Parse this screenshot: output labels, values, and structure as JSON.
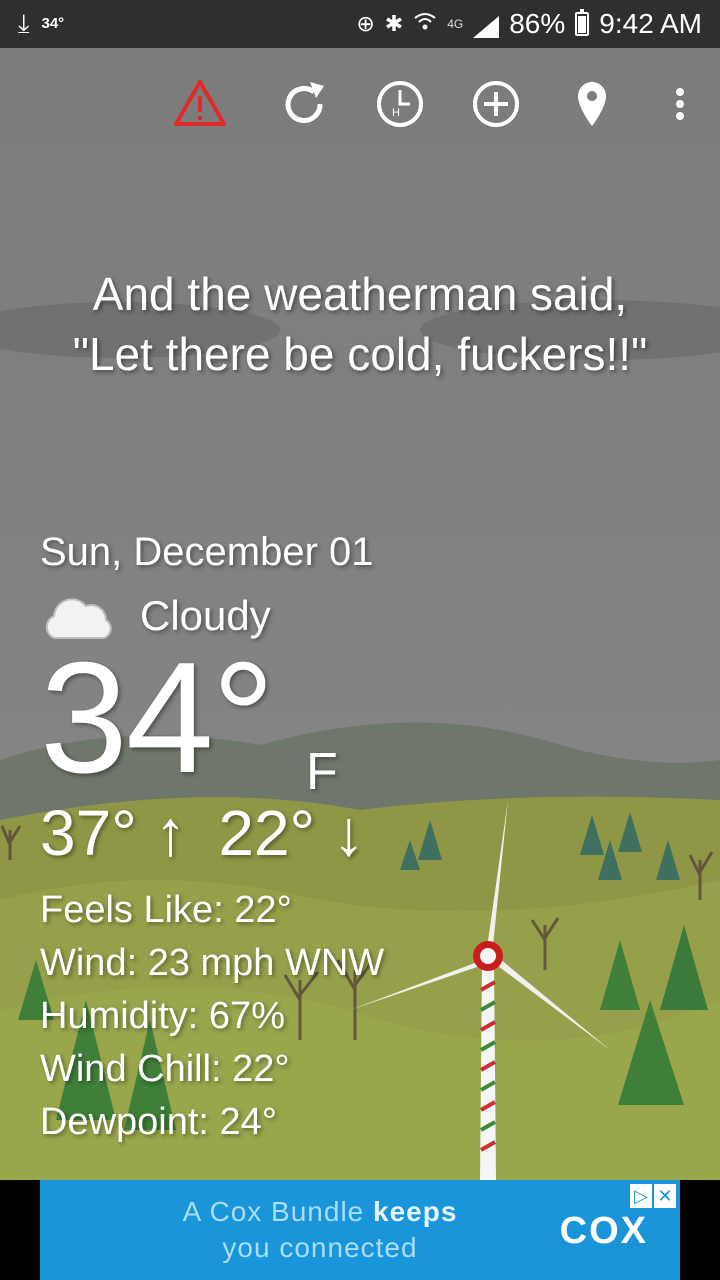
{
  "status_bar": {
    "left_temp": "34°",
    "battery": "86%",
    "network": "4G",
    "time": "9:42 AM"
  },
  "toolbar": {
    "icons": [
      "alert-icon",
      "refresh-icon",
      "history-clock-icon",
      "add-location-icon",
      "location-pin-icon",
      "more-vertical-icon"
    ],
    "alert_color": "#e02a2a"
  },
  "tagline": "And the weatherman said, \"Let there be cold, fuckers!!\"",
  "weather": {
    "date": "Sun, December 01",
    "condition": "Cloudy",
    "temperature": "34°",
    "unit": "F",
    "high": "37°",
    "low": "22°",
    "details": [
      "Feels Like: 22°",
      "Wind: 23 mph WNW",
      "Humidity: 67%",
      "Wind Chill: 22°",
      "Dewpoint: 24°"
    ]
  },
  "ad": {
    "text_a": "A Cox Bundle",
    "text_b": "keeps",
    "text_c": "you connected",
    "brand": "COX",
    "background": "#1a95da"
  }
}
